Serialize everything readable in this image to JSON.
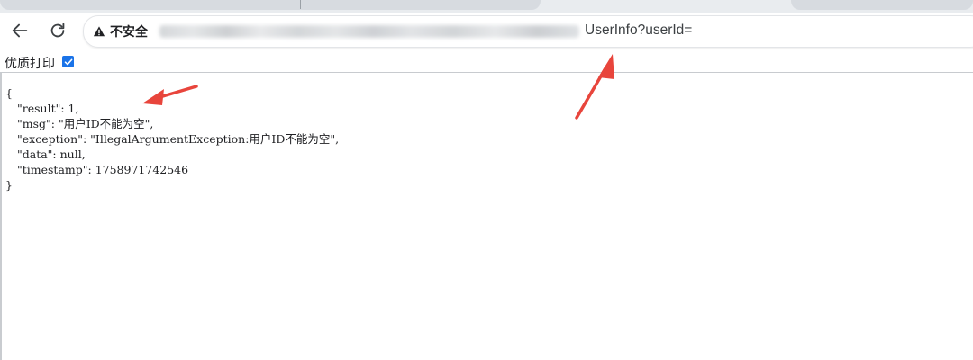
{
  "browser": {
    "security_label": "不安全",
    "url_visible": "UserInfo?userId="
  },
  "bookmarks_bar": {
    "item_label": "优质打印",
    "item_checked": true
  },
  "json_view": {
    "open_brace": "{",
    "close_brace": "}",
    "lines": [
      "\"result\": 1,",
      "\"msg\": \"用户ID不能为空\",",
      "\"exception\": \"IllegalArgumentException:用户ID不能为空\",",
      "\"data\": null,",
      "\"timestamp\": 1758971742546"
    ]
  },
  "colors": {
    "annotation_arrow": "#e8453c",
    "checkbox": "#1a73e8"
  },
  "icons": [
    "back-arrow-icon",
    "reload-icon",
    "warning-triangle-icon",
    "checkbox-icon"
  ]
}
